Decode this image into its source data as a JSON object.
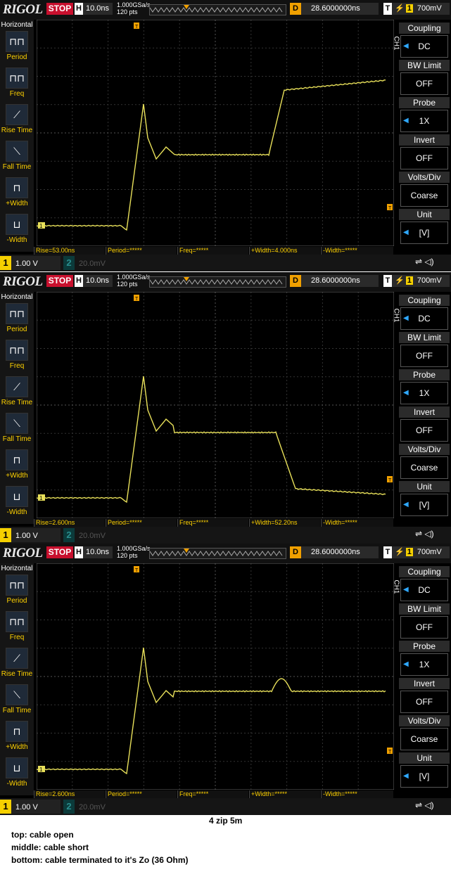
{
  "scopes": [
    {
      "brand": "RIGOL",
      "run_state": "STOP",
      "timebase_label": "H",
      "timebase": "10.0ns",
      "sample_rate": "1.000GSa/s",
      "points": "120  pts",
      "trig_delay_label": "D",
      "trig_delay": "28.6000000ns",
      "trig_label": "T",
      "trig_level": "700mV",
      "left_panel": {
        "title": "Horizontal",
        "items": [
          "Period",
          "Freq",
          "Rise Time",
          "Fall Time",
          "+Width",
          "-Width"
        ]
      },
      "right_panel": {
        "channel": "CH1",
        "items": [
          {
            "label": "Coupling",
            "value": "DC"
          },
          {
            "label": "BW Limit",
            "value": "OFF"
          },
          {
            "label": "Probe",
            "value": "1X"
          },
          {
            "label": "Invert",
            "value": "OFF"
          },
          {
            "label": "Volts/Div",
            "value": "Coarse"
          },
          {
            "label": "Unit",
            "value": "[V]"
          }
        ]
      },
      "measurements": [
        "Rise=53.00ns",
        "Period=*****",
        "Freq=*****",
        "+Width=4.000ns",
        "-Width=*****"
      ],
      "ch1_scale": "1.00 V",
      "ch2_scale": "20.0mV",
      "trace": "open"
    },
    {
      "brand": "RIGOL",
      "run_state": "STOP",
      "timebase_label": "H",
      "timebase": "10.0ns",
      "sample_rate": "1.000GSa/s",
      "points": "120  pts",
      "trig_delay_label": "D",
      "trig_delay": "28.6000000ns",
      "trig_label": "T",
      "trig_level": "700mV",
      "left_panel": {
        "title": "Horizontal",
        "items": [
          "Period",
          "Freq",
          "Rise Time",
          "Fall Time",
          "+Width",
          "-Width"
        ]
      },
      "right_panel": {
        "channel": "CH1",
        "items": [
          {
            "label": "Coupling",
            "value": "DC"
          },
          {
            "label": "BW Limit",
            "value": "OFF"
          },
          {
            "label": "Probe",
            "value": "1X"
          },
          {
            "label": "Invert",
            "value": "OFF"
          },
          {
            "label": "Volts/Div",
            "value": "Coarse"
          },
          {
            "label": "Unit",
            "value": "[V]"
          }
        ]
      },
      "measurements": [
        "Rise=2.600ns",
        "Period=*****",
        "Freq=*****",
        "+Width=52.20ns",
        "-Width=*****"
      ],
      "ch1_scale": "1.00 V",
      "ch2_scale": "20.0mV",
      "trace": "short"
    },
    {
      "brand": "RIGOL",
      "run_state": "STOP",
      "timebase_label": "H",
      "timebase": "10.0ns",
      "sample_rate": "1.000GSa/s",
      "points": "120  pts",
      "trig_delay_label": "D",
      "trig_delay": "28.6000000ns",
      "trig_label": "T",
      "trig_level": "700mV",
      "left_panel": {
        "title": "Horizontal",
        "items": [
          "Period",
          "Freq",
          "Rise Time",
          "Fall Time",
          "+Width",
          "-Width"
        ]
      },
      "right_panel": {
        "channel": "CH1",
        "items": [
          {
            "label": "Coupling",
            "value": "DC"
          },
          {
            "label": "BW Limit",
            "value": "OFF"
          },
          {
            "label": "Probe",
            "value": "1X"
          },
          {
            "label": "Invert",
            "value": "OFF"
          },
          {
            "label": "Volts/Div",
            "value": "Coarse"
          },
          {
            "label": "Unit",
            "value": "[V]"
          }
        ]
      },
      "measurements": [
        "Rise=2.600ns",
        "Period=*****",
        "Freq=*****",
        "+Width=*****",
        "-Width=*****"
      ],
      "ch1_scale": "1.00 V",
      "ch2_scale": "20.0mV",
      "trace": "terminated"
    }
  ],
  "caption": {
    "title": "4 zip 5m",
    "lines": [
      "top: cable open",
      "middle: cable short",
      "bottom: cable terminated to it's Zo (36 Ohm)"
    ]
  },
  "colors": {
    "trace": "#e8e05a",
    "trigger": "#f0a000",
    "accent_blue": "#2fa8ff",
    "stop": "#c8102e"
  }
}
